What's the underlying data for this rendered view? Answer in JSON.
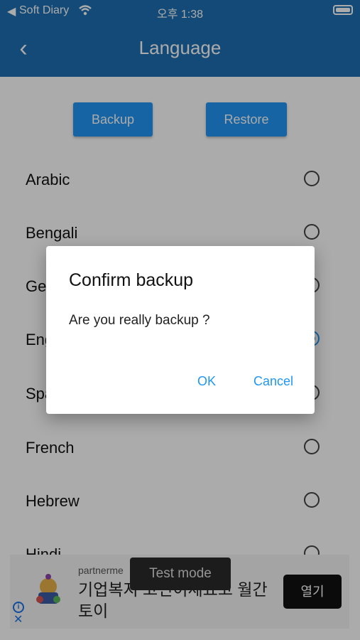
{
  "status_bar": {
    "back_glyph": "◀",
    "carrier": "Soft Diary",
    "wifi_glyph": "wifi-icon",
    "time": "오후 1:38",
    "battery": "battery-icon"
  },
  "app_bar": {
    "back_glyph": "‹",
    "title": "Language"
  },
  "actions": {
    "backup_label": "Backup",
    "restore_label": "Restore"
  },
  "languages": [
    {
      "label": "Arabic",
      "selected": false
    },
    {
      "label": "Bengali",
      "selected": false
    },
    {
      "label": "German",
      "selected": false
    },
    {
      "label": "English",
      "selected": true
    },
    {
      "label": "Spanish",
      "selected": false
    },
    {
      "label": "French",
      "selected": false
    },
    {
      "label": "Hebrew",
      "selected": false
    },
    {
      "label": "Hindi",
      "selected": false
    }
  ],
  "dialog": {
    "title": "Confirm backup",
    "message": "Are you really backup ?",
    "ok_label": "OK",
    "cancel_label": "Cancel"
  },
  "toast": {
    "text": "Test mode"
  },
  "ad": {
    "advertiser": "partnerme",
    "headline": "기업복지 고민이세요고 월간토이",
    "cta_label": "열기",
    "info_glyph": "i",
    "close_glyph": "✕"
  },
  "colors": {
    "primary": "#1f6fb2",
    "accent": "#2196f3"
  }
}
